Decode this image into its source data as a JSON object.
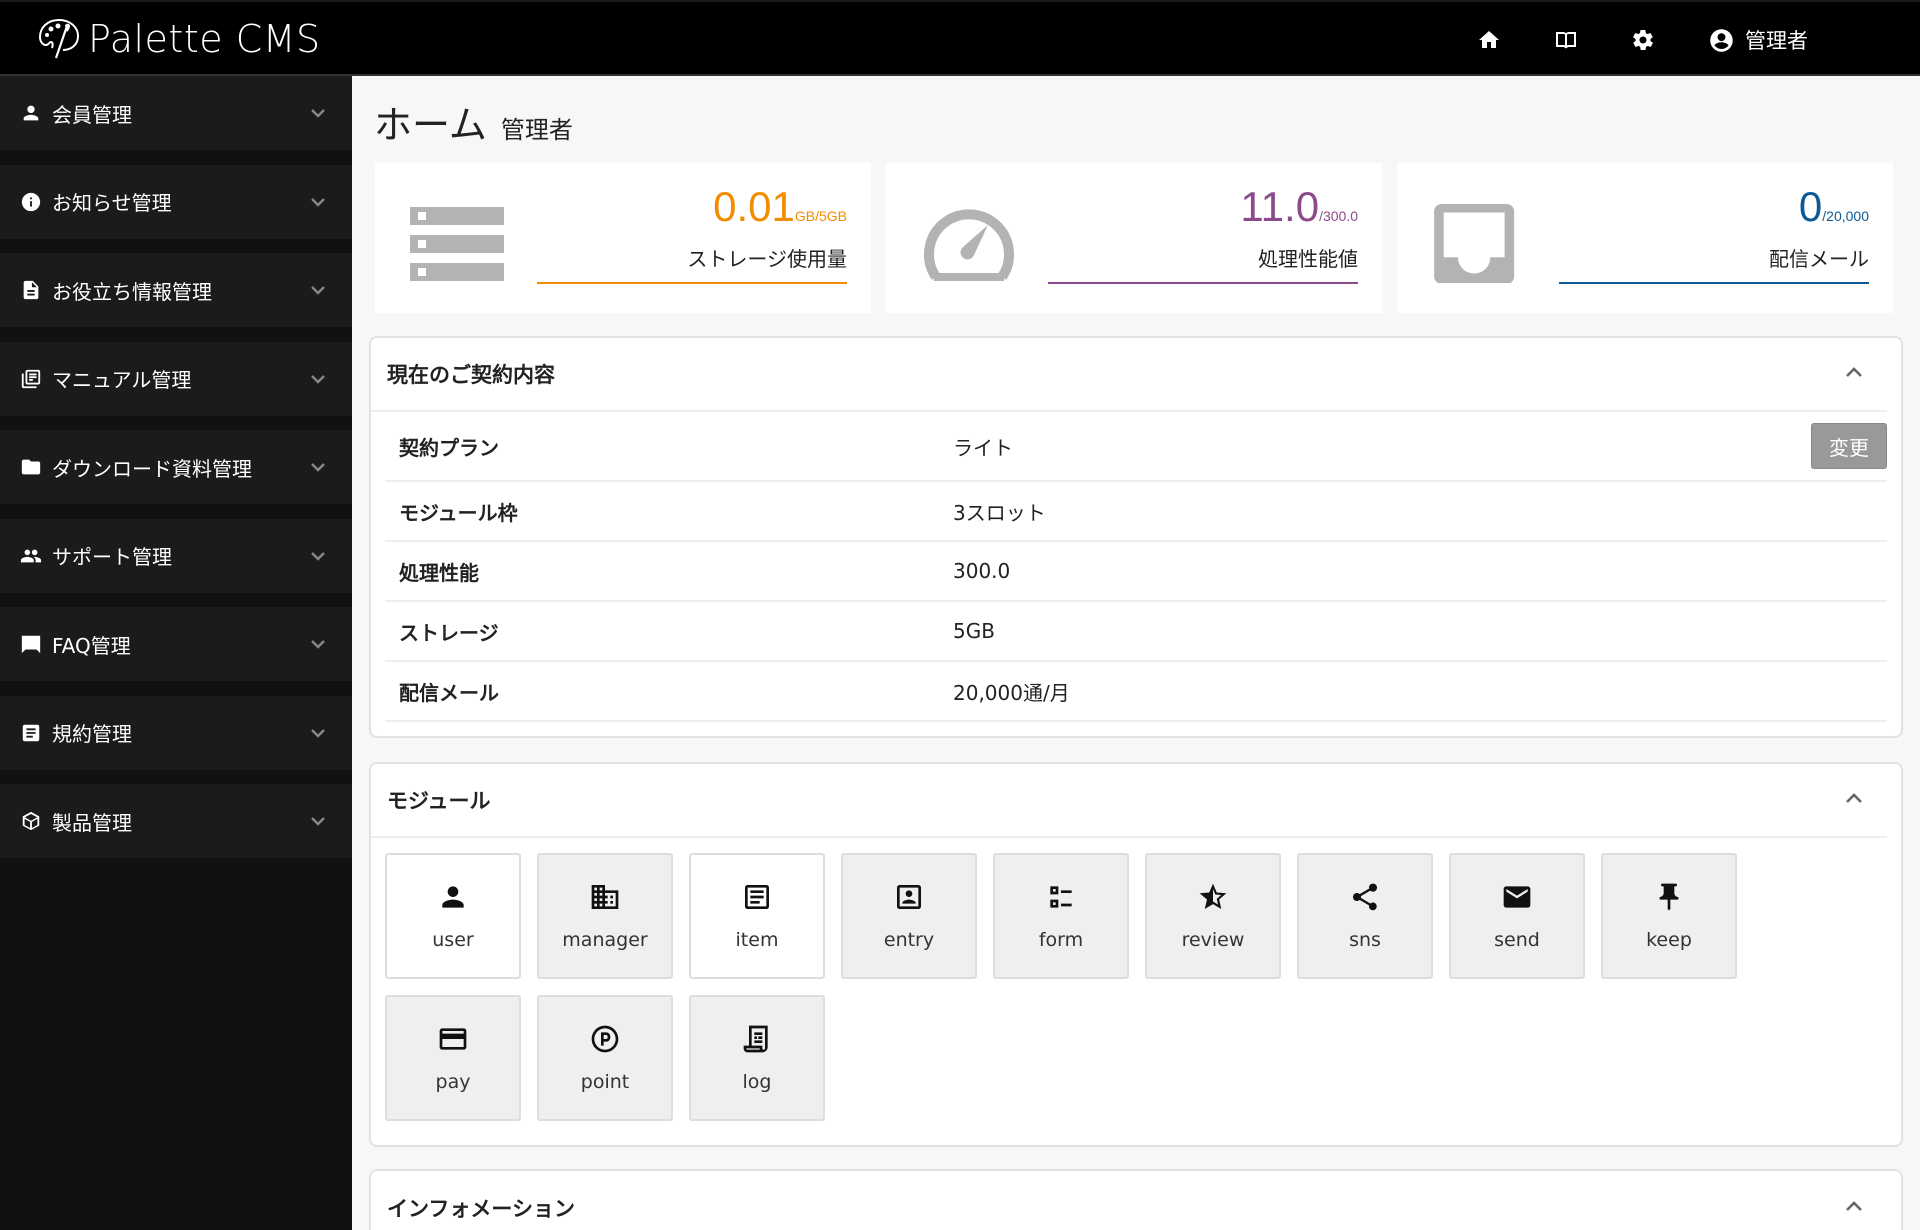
{
  "header": {
    "brand": "Palette CMS",
    "nav_icons": [
      {
        "name": "home-icon"
      },
      {
        "name": "book-icon"
      },
      {
        "name": "gear-icon"
      }
    ],
    "user_label": "管理者"
  },
  "sidebar": {
    "items": [
      {
        "label": "会員管理",
        "icon": "person-icon"
      },
      {
        "label": "お知らせ管理",
        "icon": "info-icon"
      },
      {
        "label": "お役立ち情報管理",
        "icon": "document-icon"
      },
      {
        "label": "マニュアル管理",
        "icon": "library-books-icon"
      },
      {
        "label": "ダウンロード資料管理",
        "icon": "folder-icon"
      },
      {
        "label": "サポート管理",
        "icon": "people-icon"
      },
      {
        "label": "FAQ管理",
        "icon": "chat-bubble-icon"
      },
      {
        "label": "規約管理",
        "icon": "article-icon"
      },
      {
        "label": "製品管理",
        "icon": "cube-icon"
      }
    ]
  },
  "page": {
    "title": "ホーム",
    "subtitle": "管理者"
  },
  "stats": [
    {
      "value": "0.01",
      "unit": "GB/5GB",
      "label": "ストレージ使用量",
      "color": "#f28c00",
      "icon": "storage-icon"
    },
    {
      "value": "11.0",
      "unit": "/300.0",
      "label": "処理性能値",
      "color": "#8a4a8c",
      "icon": "speedometer-icon"
    },
    {
      "value": "0",
      "unit": "/20,000",
      "label": "配信メール",
      "color": "#0d5a96",
      "icon": "inbox-icon"
    }
  ],
  "contract": {
    "title": "現在のご契約内容",
    "change_button": "変更",
    "rows": [
      {
        "key": "契約プラン",
        "value": "ライト"
      },
      {
        "key": "モジュール枠",
        "value": "3スロット"
      },
      {
        "key": "処理性能",
        "value": "300.0"
      },
      {
        "key": "ストレージ",
        "value": "5GB"
      },
      {
        "key": "配信メール",
        "value": "20,000通/月"
      }
    ]
  },
  "modules": {
    "title": "モジュール",
    "items": [
      {
        "label": "user",
        "active": true
      },
      {
        "label": "manager",
        "active": false
      },
      {
        "label": "item",
        "active": true
      },
      {
        "label": "entry",
        "active": false
      },
      {
        "label": "form",
        "active": false
      },
      {
        "label": "review",
        "active": false
      },
      {
        "label": "sns",
        "active": false
      },
      {
        "label": "send",
        "active": false
      },
      {
        "label": "keep",
        "active": false
      },
      {
        "label": "pay",
        "active": false
      },
      {
        "label": "point",
        "active": false
      },
      {
        "label": "log",
        "active": false
      }
    ]
  },
  "information": {
    "title": "インフォメーション"
  }
}
